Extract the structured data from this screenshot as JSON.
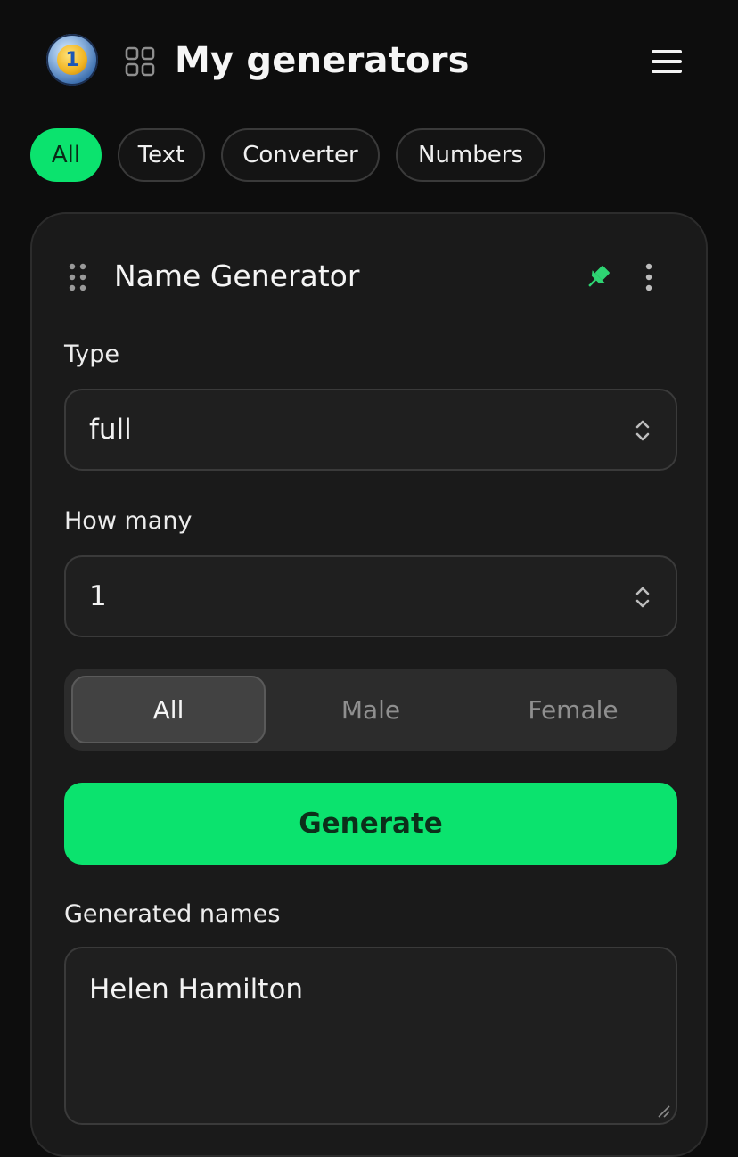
{
  "header": {
    "title": "My generators",
    "logo_icon": "coin-one-logo",
    "logo_text": "1",
    "grid_icon": "grid-icon",
    "menu_icon": "hamburger-menu-icon"
  },
  "filters": [
    {
      "label": "All",
      "active": true
    },
    {
      "label": "Text",
      "active": false
    },
    {
      "label": "Converter",
      "active": false
    },
    {
      "label": "Numbers",
      "active": false
    }
  ],
  "card": {
    "title": "Name Generator",
    "type_label": "Type",
    "type_value": "full",
    "count_label": "How many",
    "count_value": "1",
    "gender_options": [
      {
        "label": "All",
        "active": true
      },
      {
        "label": "Male",
        "active": false
      },
      {
        "label": "Female",
        "active": false
      }
    ],
    "generate_label": "Generate",
    "output_label": "Generated names",
    "output_value": "Helen Hamilton"
  },
  "colors": {
    "accent": "#0be36e",
    "background": "#0d0d0d",
    "card": "#1a1a1a"
  }
}
